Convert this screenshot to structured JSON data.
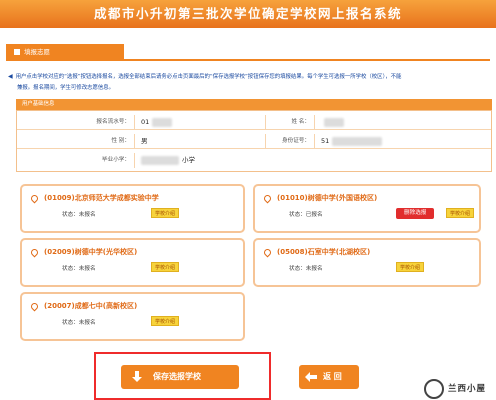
{
  "header": {
    "title": "成都市小升初第三批次学位确定学校网上报名系统"
  },
  "section": {
    "title": "填报志愿"
  },
  "notice": {
    "line1": "用户点击学校对应的“选报”按钮选择报名，选报全部结束后请务必点击页面最后的“保存选报学校”按钮保存您的填报结果。每个学生可选报一所学校（校区），不能",
    "line2": "兼报。报名期间，学生可修改志愿信息。"
  },
  "student_info": {
    "header": "用户基础信息",
    "labels": {
      "reg_no": "报名流水号：",
      "name": "姓 名：",
      "gender": "性 别：",
      "id_no": "身份证号：",
      "school": "毕业小学："
    },
    "values": {
      "reg_no": "01",
      "name": "",
      "gender": "男",
      "id_no": "51",
      "school": "小学"
    }
  },
  "schools": [
    {
      "code_name": "(01009)北京师范大学成都实验中学",
      "status": "状态：未报名",
      "badge": "学校介绍"
    },
    {
      "code_name": "(01010)树德中学(外国语校区)",
      "status": "状态：已报名",
      "badge": "学校介绍",
      "delete_label": "删除选报"
    },
    {
      "code_name": "(02009)树德中学(光华校区)",
      "status": "状态：未报名",
      "badge": "学校介绍"
    },
    {
      "code_name": "(05008)石室中学(北湖校区)",
      "status": "状态：未报名",
      "badge": "学校介绍"
    },
    {
      "code_name": "(20007)成都七中(高新校区)",
      "status": "状态：未报名",
      "badge": "学校介绍"
    }
  ],
  "buttons": {
    "save": "保存选报学校",
    "back": "返 回"
  },
  "watermark": {
    "text": "兰西小屋"
  },
  "colors": {
    "accent": "#f08421",
    "highlight": "#ef2b2b",
    "delete": "#e12d2d",
    "link": "#1b4aa0"
  }
}
